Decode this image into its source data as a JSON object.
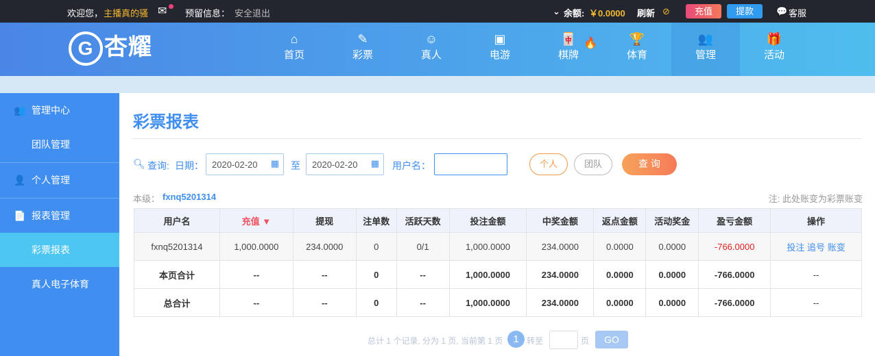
{
  "topbar": {
    "welcome": "欢迎您，",
    "username": "主播真的骚",
    "reserved": "预留信息：",
    "logout": "安全退出",
    "balance_label": "余额:",
    "balance": "￥0.0000",
    "refresh": "刷新",
    "deposit": "充值",
    "withdraw": "提款",
    "service": "客服"
  },
  "logo": {
    "text": "杏耀"
  },
  "nav": [
    {
      "label": "首页",
      "icon": "home-icon"
    },
    {
      "label": "彩票",
      "icon": "ticket-icon"
    },
    {
      "label": "真人",
      "icon": "person-icon"
    },
    {
      "label": "电游",
      "icon": "slot-icon"
    },
    {
      "label": "棋牌",
      "icon": "mahjong-icon"
    },
    {
      "label": "体育",
      "icon": "trophy-icon"
    },
    {
      "label": "管理",
      "icon": "users-icon"
    },
    {
      "label": "活动",
      "icon": "gift-icon"
    }
  ],
  "sidebar": [
    {
      "label": "管理中心"
    },
    {
      "label": "团队管理"
    },
    {
      "label": "个人管理"
    },
    {
      "label": "报表管理"
    },
    {
      "label": "彩票报表"
    },
    {
      "label": "真人电子体育"
    }
  ],
  "page": {
    "title": "彩票报表",
    "query": "查询:",
    "date_label": "日期：",
    "date_from": "2020-02-20",
    "to": "至",
    "date_to": "2020-02-20",
    "user_label": "用户名：",
    "user_value": "",
    "personal": "个人",
    "team": "团队",
    "search": "查 询",
    "level_label": "本级：",
    "level_user": "fxnq5201314",
    "note": "注: 此处账变为彩票账变"
  },
  "table": {
    "headers": [
      "用户名",
      "充值 ▼",
      "提现",
      "注单数",
      "活跃天数",
      "投注金额",
      "中奖金额",
      "返点金额",
      "活动奖金",
      "盈亏金额",
      "操作"
    ],
    "rows": [
      [
        "fxnq5201314",
        "1,000.0000",
        "234.0000",
        "0",
        "0/1",
        "1,000.0000",
        "234.0000",
        "0.0000",
        "0.0000",
        "-766.0000"
      ],
      [
        "本页合计",
        "--",
        "--",
        "0",
        "--",
        "1,000.0000",
        "234.0000",
        "0.0000",
        "0.0000",
        "-766.0000",
        "--"
      ],
      [
        "总合计",
        "--",
        "--",
        "0",
        "--",
        "1,000.0000",
        "234.0000",
        "0.0000",
        "0.0000",
        "-766.0000",
        "--"
      ]
    ],
    "actions": [
      "投注",
      "追号",
      "账变"
    ]
  },
  "pager": {
    "summary": "总计 1 个记录, 分为 1 页, 当前第 1 页",
    "current": "1",
    "goto": "转至",
    "page_unit": "页",
    "go": "GO"
  }
}
